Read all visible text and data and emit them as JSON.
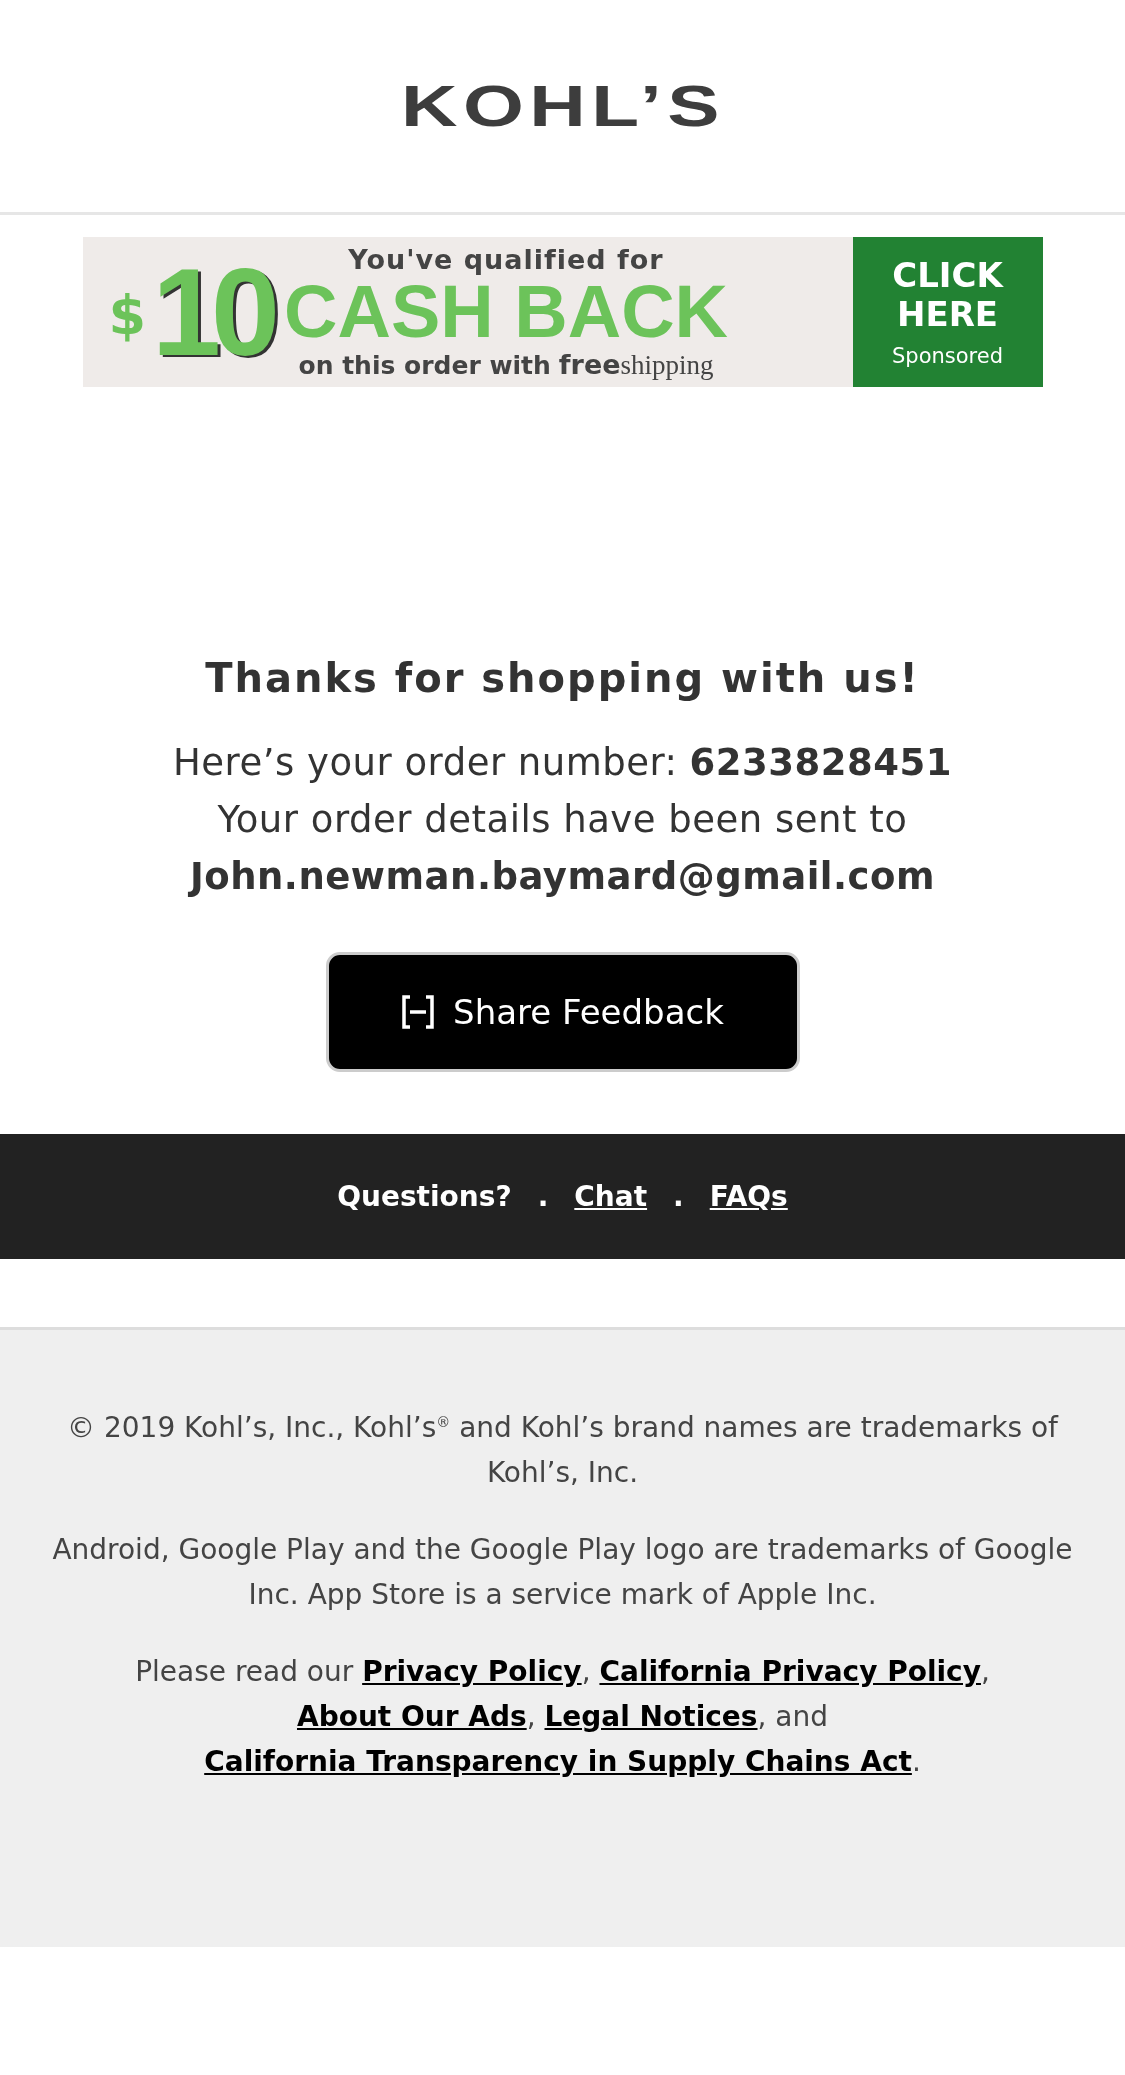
{
  "header": {
    "logo": "KOHL’S"
  },
  "ad_banner": {
    "prefix": "$",
    "amount": "10",
    "headline": "You've qualified for",
    "offer": "CASH BACK",
    "subline": "on this order with",
    "brand_bold": "free",
    "brand_rest": "shipping",
    "cta": "CLICK HERE",
    "sponsored": "Sponsored"
  },
  "confirmation": {
    "title": "Thanks for shopping with us!",
    "order_label": "Here’s your order number:",
    "order_number": "6233828451",
    "sent_to": "Your order details have been sent to",
    "email": "John.newman.baymard@gmail.com",
    "feedback_button": "Share Feedback"
  },
  "help_bar": [
    {
      "kind": "label",
      "text": "Questions?"
    },
    {
      "kind": "separator",
      "text": "."
    },
    {
      "kind": "link",
      "text": "Chat"
    },
    {
      "kind": "separator",
      "text": "."
    },
    {
      "kind": "link",
      "text": "FAQs"
    }
  ],
  "legal": {
    "copyright": "© 2019 Kohl’s, Inc., Kohl’s$^{®}$ and Kohl’s brand names are trademarks of Kohl’s, Inc.",
    "trademarks": "Android, Google Play and the Google Play logo are trademarks of Google Inc. App Store is a service mark of Apple Inc.",
    "links_paragraph": [
      {
        "kind": "text",
        "text": "Please read our "
      },
      {
        "kind": "link",
        "text": "Privacy Policy"
      },
      {
        "kind": "text",
        "text": ", "
      },
      {
        "kind": "link",
        "text": "California Privacy Policy"
      },
      {
        "kind": "text",
        "text": ", "
      },
      {
        "kind": "link",
        "text": "About Our Ads"
      },
      {
        "kind": "text",
        "text": ", "
      },
      {
        "kind": "link",
        "text": "Legal Notices"
      },
      {
        "kind": "text",
        "text": ", and "
      },
      {
        "kind": "link",
        "text": "California Transparency in Supply Chains Act"
      },
      {
        "kind": "text",
        "text": "."
      }
    ]
  }
}
